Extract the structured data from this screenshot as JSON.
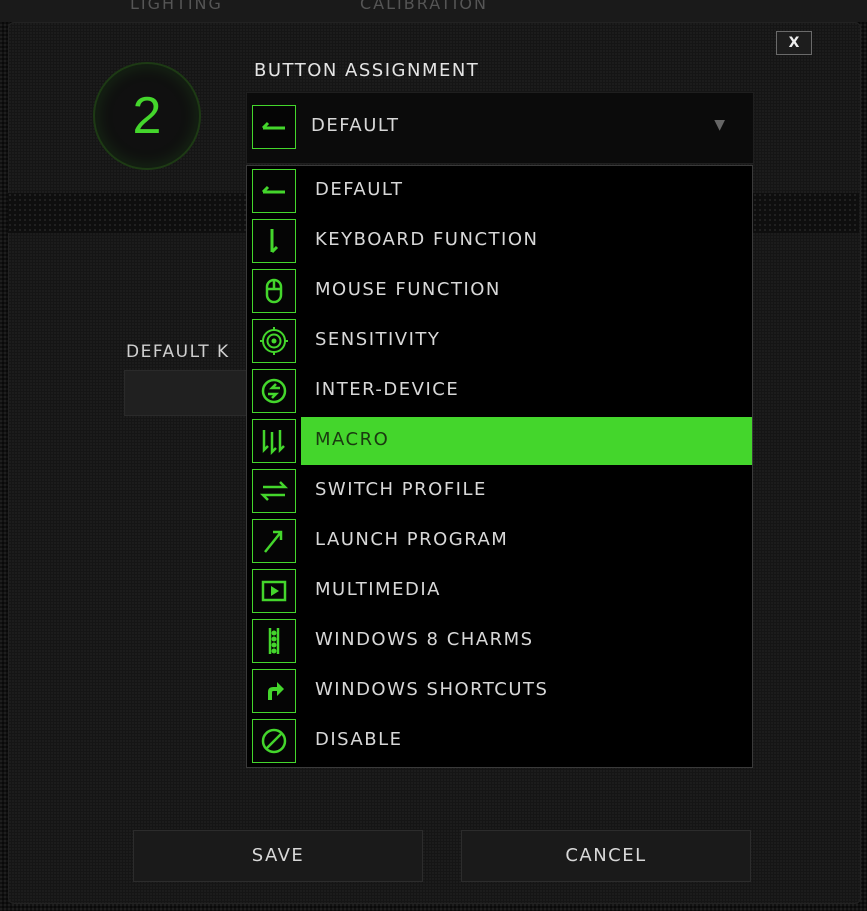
{
  "background_tabs": [
    "LIGHTING",
    "CALIBRATION"
  ],
  "dialog": {
    "close_label": "X",
    "button_number": "2",
    "section_title": "BUTTON ASSIGNMENT",
    "dropdown_value": "DEFAULT",
    "accent_color": "#44d62c"
  },
  "menu": {
    "items": [
      {
        "label": "DEFAULT",
        "icon": "default-arrow-icon"
      },
      {
        "label": "KEYBOARD FUNCTION",
        "icon": "keyboard-function-icon"
      },
      {
        "label": "MOUSE FUNCTION",
        "icon": "mouse-icon"
      },
      {
        "label": "SENSITIVITY",
        "icon": "sensitivity-target-icon"
      },
      {
        "label": "INTER-DEVICE",
        "icon": "inter-device-icon"
      },
      {
        "label": "MACRO",
        "icon": "macro-icon",
        "selected": true
      },
      {
        "label": "SWITCH PROFILE",
        "icon": "switch-profile-icon"
      },
      {
        "label": "LAUNCH PROGRAM",
        "icon": "launch-program-icon"
      },
      {
        "label": "MULTIMEDIA",
        "icon": "multimedia-play-icon"
      },
      {
        "label": "WINDOWS 8 CHARMS",
        "icon": "windows-charms-icon"
      },
      {
        "label": "WINDOWS SHORTCUTS",
        "icon": "windows-shortcut-icon"
      },
      {
        "label": "DISABLE",
        "icon": "disable-icon"
      }
    ]
  },
  "default_key": {
    "label": "DEFAULT K"
  },
  "footer": {
    "save_label": "SAVE",
    "cancel_label": "CANCEL"
  }
}
